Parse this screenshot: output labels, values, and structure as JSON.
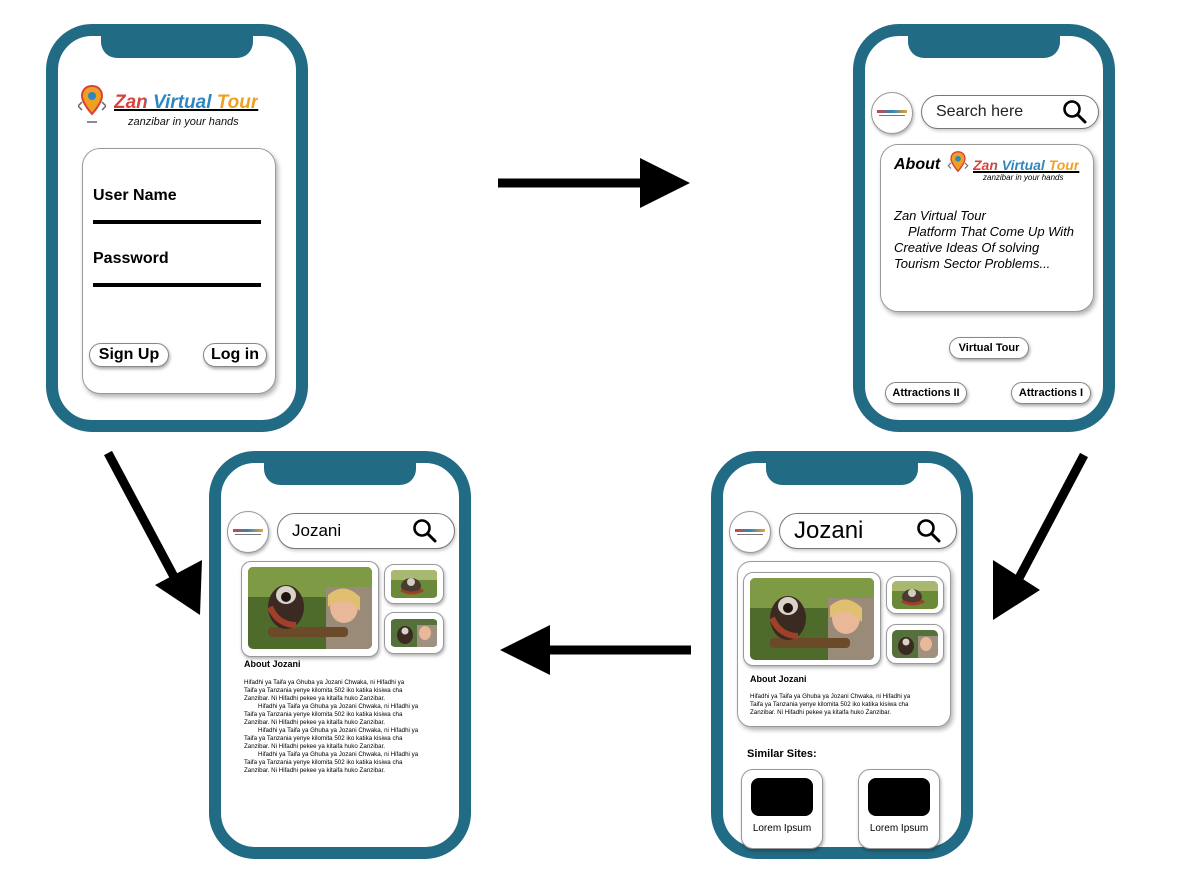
{
  "login": {
    "logo_title": "Zan Virtual Tour",
    "logo_tagline": "zanzibar in your hands",
    "username_label": "User Name",
    "password_label": "Password",
    "signup_label": "Sign Up",
    "login_label": "Log in"
  },
  "home": {
    "search_placeholder": "Search here",
    "about_word": "About",
    "logo_title": "Zan Virtual Tour",
    "logo_tagline": "zanzibar in your hands",
    "about_line1": "Zan Virtual Tour",
    "about_line2": "Platform That Come Up With",
    "about_line3": "Creative Ideas Of solving",
    "about_line4": "Tourism Sector Problems...",
    "virtual_tour_label": "Virtual Tour",
    "attractions2_label": "Attractions II",
    "attractions1_label": "Attractions I"
  },
  "site": {
    "search_value": "Jozani",
    "about_heading": "About Jozani",
    "desc_line1": "Hifadhi ya Taifa ya Ghuba ya Jozani Chwaka, ni Hifadhi ya",
    "desc_line2": "Taifa ya Tanzania yenye kilomita 502 iko katika kisiwa cha",
    "desc_line3": "Zanzibar. Ni Hifadhi pekee ya kitaifa huko Zanzibar.",
    "similar_heading": "Similar Sites:",
    "similar_items": [
      "Lorem Ipsum",
      "Lorem Ipsum"
    ]
  },
  "detail": {
    "search_value": "Jozani",
    "about_heading": "About Jozani",
    "paragraphs": [
      [
        "Hifadhi ya Taifa ya Ghuba ya Jozani Chwaka, ni Hifadhi ya",
        "Taifa ya Tanzania yenye kilomita 502 iko katika kisiwa cha",
        "Zanzibar. Ni Hifadhi pekee ya kitaifa huko Zanzibar."
      ],
      [
        "Hifadhi ya Taifa ya Ghuba ya Jozani Chwaka, ni Hifadhi ya",
        "Taifa ya Tanzania yenye kilomita 502 iko katika kisiwa cha",
        "Zanzibar. Ni Hifadhi pekee ya kitaifa huko Zanzibar."
      ],
      [
        "Hifadhi ya Taifa ya Ghuba ya Jozani Chwaka, ni Hifadhi ya",
        "Taifa ya Tanzania yenye kilomita 502 iko katika kisiwa cha",
        "Zanzibar. Ni Hifadhi pekee ya kitaifa huko Zanzibar."
      ],
      [
        "Hifadhi ya Taifa ya Ghuba ya Jozani Chwaka, ni Hifadhi ya",
        "Taifa ya Tanzania yenye kilomita 502 iko katika kisiwa cha",
        "Zanzibar. Ni Hifadhi pekee ya kitaifa huko Zanzibar."
      ]
    ]
  },
  "colors": {
    "phone_frame": "#226b85",
    "logo_red": "#d9413a",
    "logo_blue": "#2e86c1",
    "logo_orange": "#f0a020"
  }
}
